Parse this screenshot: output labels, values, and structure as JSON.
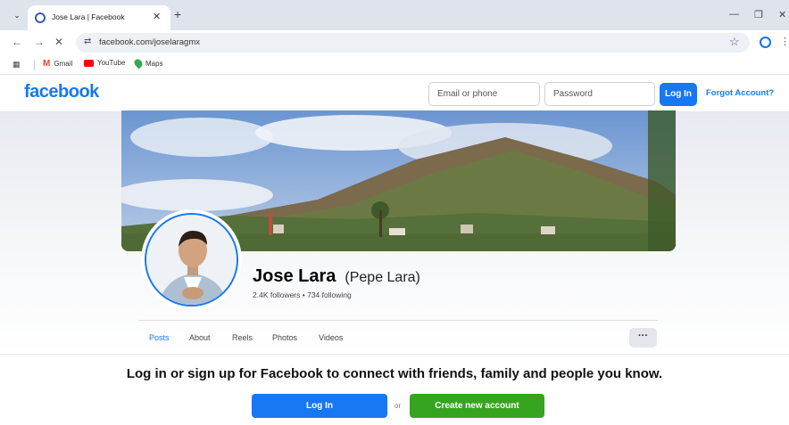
{
  "browser": {
    "tab_title": "Jose Lara | Facebook",
    "tab_close": "✕",
    "new_tab": "+",
    "tab_menu": "⌄",
    "url": "facebook.com/joselaragmx",
    "win_min": "—",
    "win_restore": "❐",
    "win_close": "✕",
    "bookmarks": [
      {
        "label": "Gmail",
        "icon": "gmail-icon"
      },
      {
        "label": "YouTube",
        "icon": "youtube-icon"
      },
      {
        "label": "Maps",
        "icon": "maps-icon"
      }
    ]
  },
  "header": {
    "logo": "facebook",
    "email_placeholder": "Email or phone",
    "password_placeholder": "Password",
    "login_label": "Log In",
    "forgot_label": "Forgot Account?"
  },
  "profile": {
    "name": "Jose Lara",
    "nickname": "(Pepe Lara)",
    "followers": "2.4K followers • 734 following",
    "tabs": [
      "Posts",
      "About",
      "Reels",
      "Photos",
      "Videos"
    ],
    "more_label": "···"
  },
  "cta": {
    "text": "Log in or sign up for Facebook to connect with friends, family and people you know.",
    "login_label": "Log In",
    "or_label": "or",
    "create_label": "Create new account"
  },
  "colors": {
    "brand": "#1877f2",
    "create": "#36a420"
  }
}
